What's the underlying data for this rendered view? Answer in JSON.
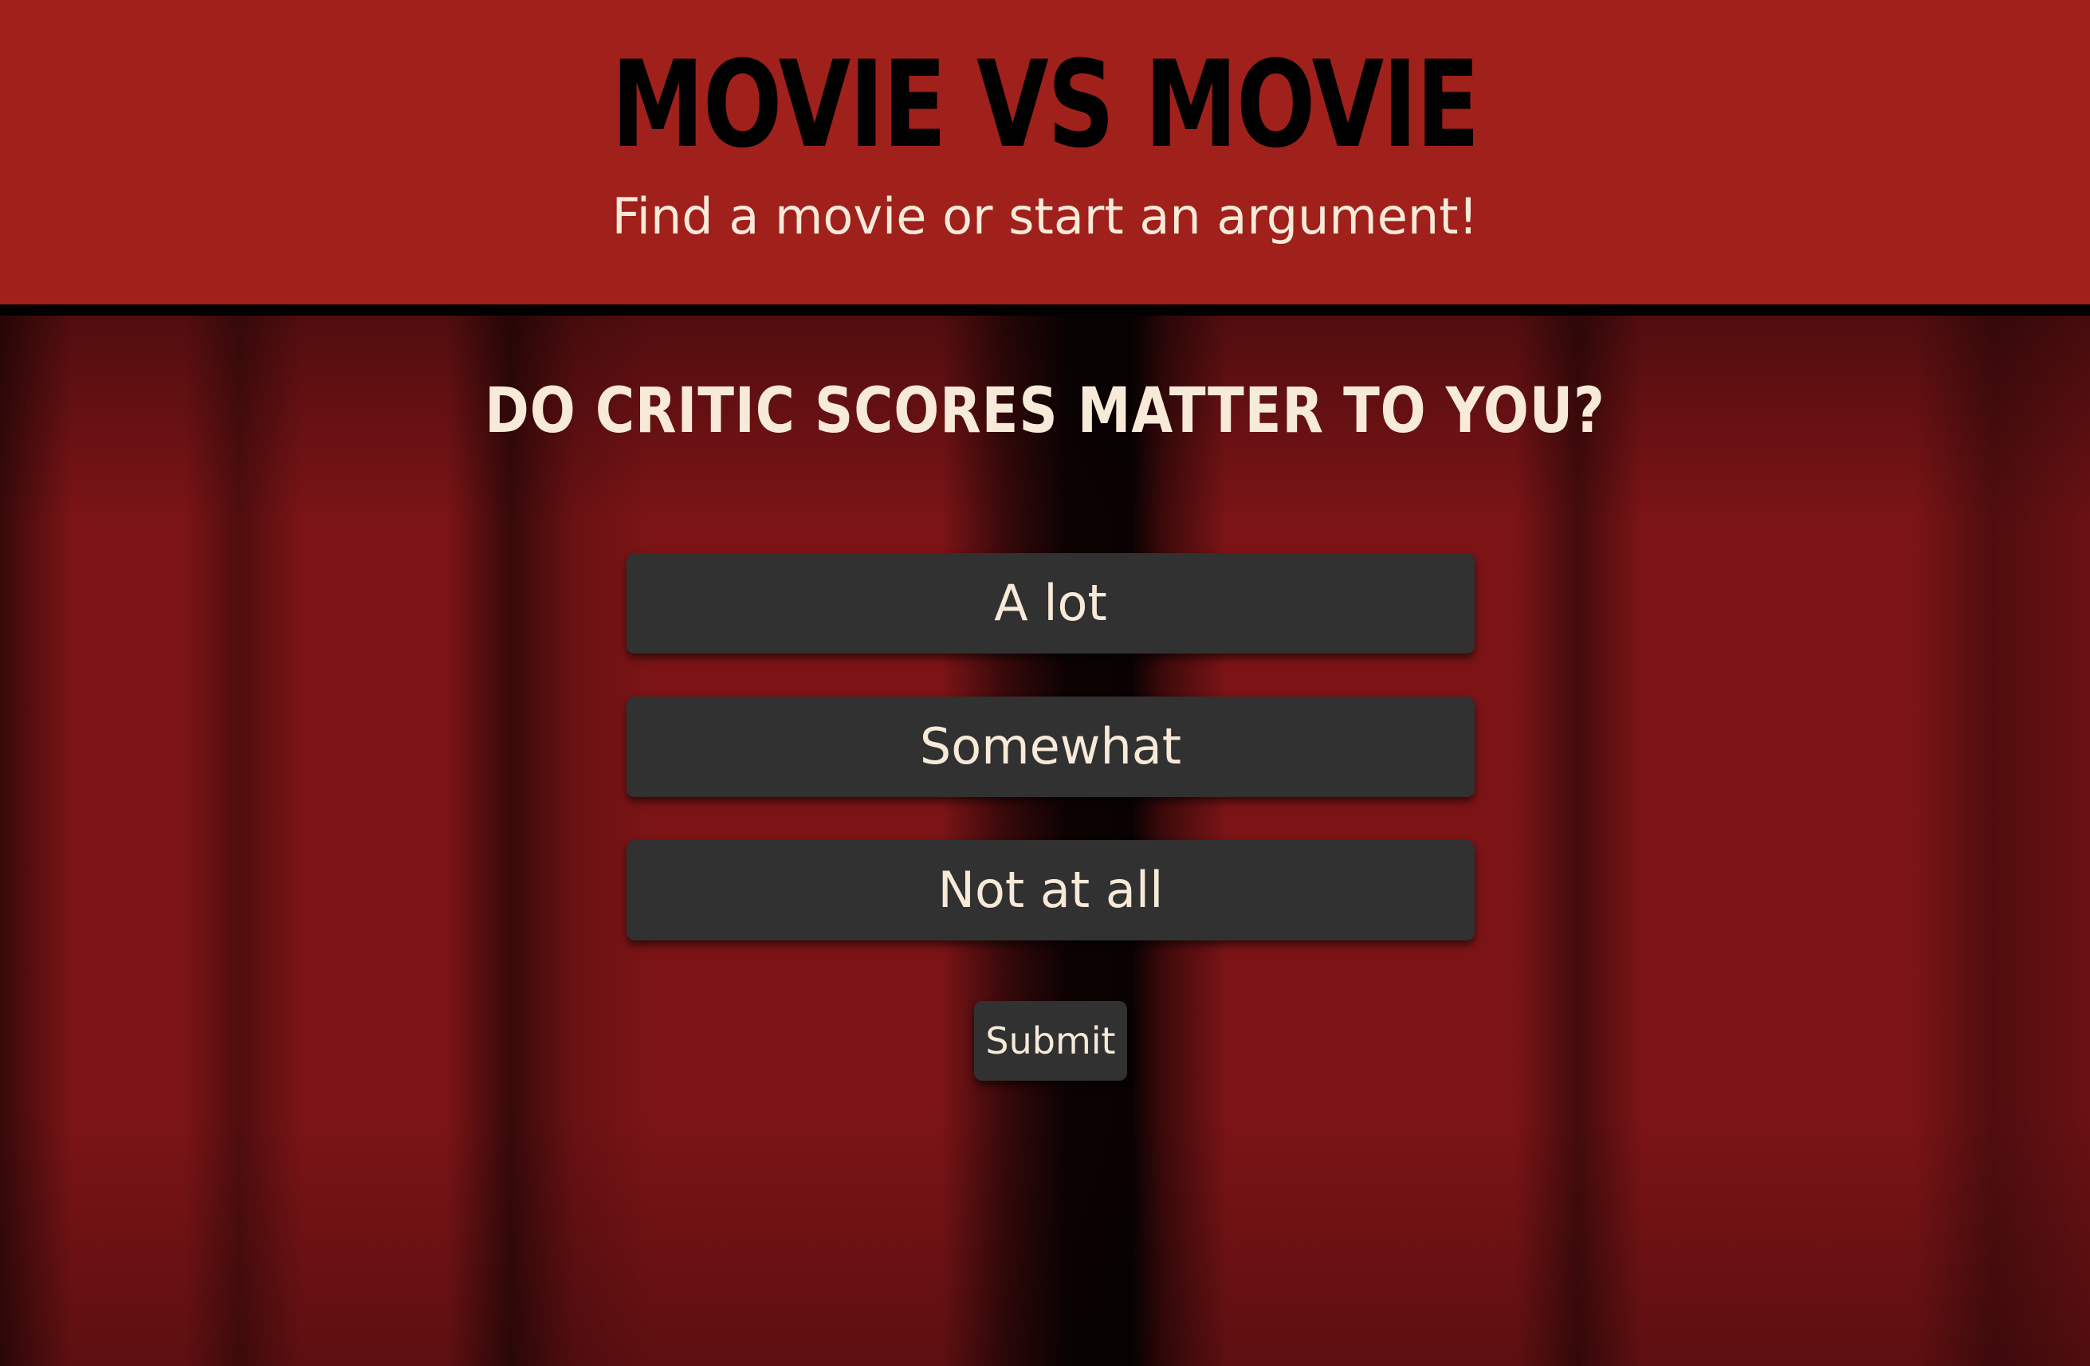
{
  "header": {
    "title": "MOVIE VS MOVIE",
    "tagline": "Find a movie or start an argument!"
  },
  "quiz": {
    "question": "DO CRITIC SCORES MATTER TO YOU?",
    "options": [
      {
        "label": "A lot"
      },
      {
        "label": "Somewhat"
      },
      {
        "label": "Not at all"
      }
    ],
    "submit_label": "Submit"
  },
  "colors": {
    "header_background": "#a0201b",
    "title_text": "#000000",
    "cream_text": "#f7ead8",
    "button_background": "#313131",
    "curtain_red": "#7c1416"
  }
}
